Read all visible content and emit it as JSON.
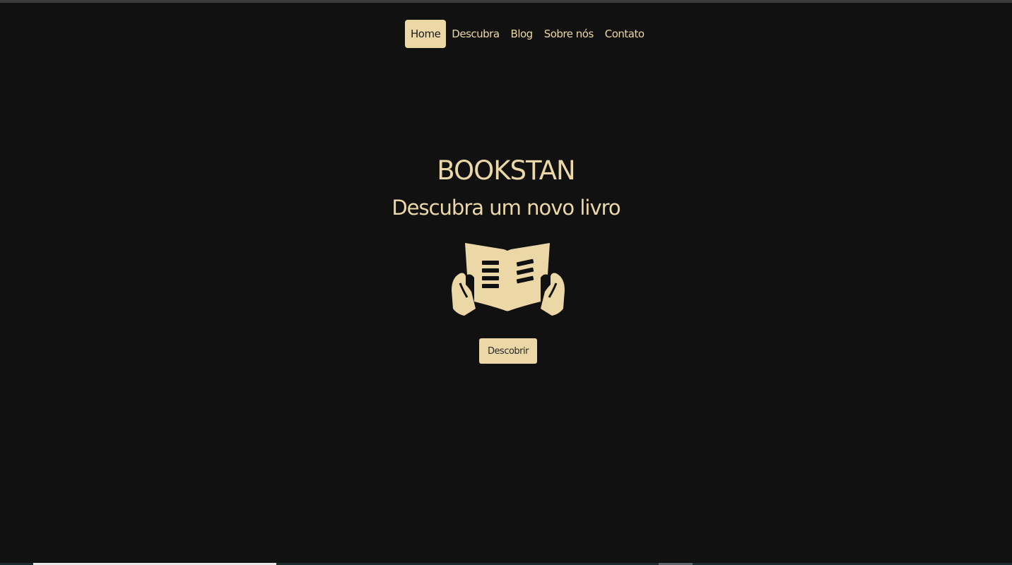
{
  "theme": {
    "background": "#111111",
    "accent": "#ebd8a6"
  },
  "nav": {
    "items": [
      {
        "label": "Home",
        "active": true
      },
      {
        "label": "Descubra",
        "active": false
      },
      {
        "label": "Blog",
        "active": false
      },
      {
        "label": "Sobre nós",
        "active": false
      },
      {
        "label": "Contato",
        "active": false
      }
    ]
  },
  "hero": {
    "title": "BOOKSTAN",
    "subtitle": "Descubra um novo livro",
    "icon": "reading-book-icon",
    "button_label": "Descobrir"
  }
}
